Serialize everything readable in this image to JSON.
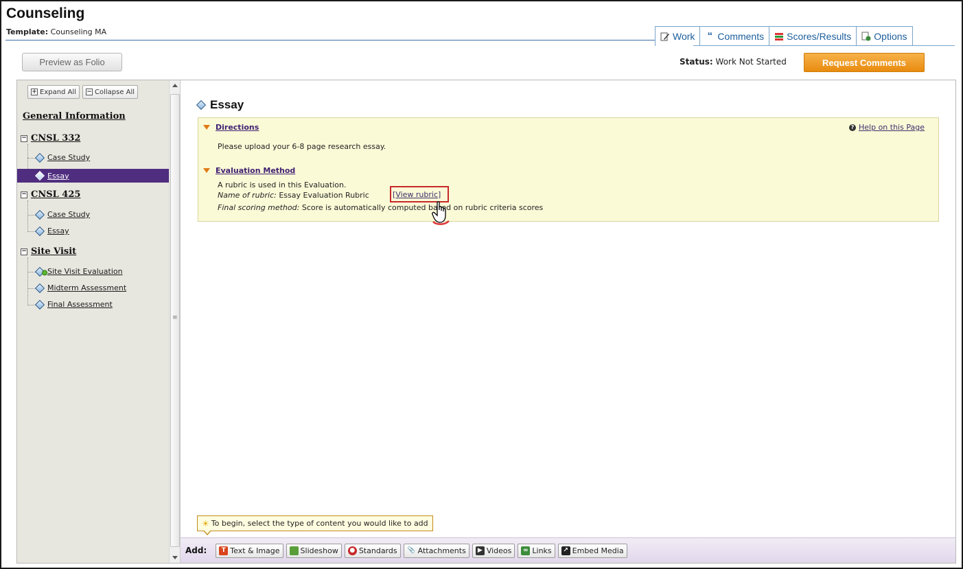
{
  "header": {
    "title": "Counseling",
    "template_label": "Template:",
    "template_value": "Counseling MA"
  },
  "tabs": [
    {
      "label": "Work",
      "icon": "pencil-page-icon"
    },
    {
      "label": "Comments",
      "icon": "quote-icon"
    },
    {
      "label": "Scores/Results",
      "icon": "scores-icon"
    },
    {
      "label": "Options",
      "icon": "options-icon"
    }
  ],
  "toolbar": {
    "preview_label": "Preview as Folio",
    "status_label": "Status:",
    "status_value": "Work Not Started",
    "request_label": "Request Comments"
  },
  "colors": {
    "accent_orange": "#e88b0f",
    "active_purple": "#4f2d7f",
    "link_purple": "#3e1f72",
    "tab_blue": "#1b5d9c"
  },
  "sidebar": {
    "expand_all": "Expand All",
    "collapse_all": "Collapse All",
    "general_info": "General Information",
    "groups": [
      {
        "label": "CNSL 332",
        "items": [
          "Case Study",
          "Essay"
        ]
      },
      {
        "label": "CNSL 425",
        "items": [
          "Case Study",
          "Essay"
        ]
      },
      {
        "label": "Site Visit",
        "items": [
          "Site Visit Evaluation",
          "Midterm Assessment",
          "Final Assessment"
        ]
      }
    ]
  },
  "content": {
    "page_title": "Essay",
    "directions_label": "Directions",
    "help_label": "Help on this Page",
    "directions_text": "Please upload your 6-8 page research essay.",
    "evaluation_label": "Evaluation Method",
    "eval_line1": "A rubric is used in this Evaluation.",
    "rubric_name_label": "Name of rubric:",
    "rubric_name_value": "Essay Evaluation Rubric",
    "view_rubric": "[View rubric]",
    "scoring_label": "Final scoring method:",
    "scoring_value": "Score is automatically computed based on rubric criteria scores"
  },
  "tooltip": "To begin, select the type of content you would like to add",
  "addbar": {
    "label": "Add:",
    "buttons": [
      "Text & Image",
      "Slideshow",
      "Standards",
      "Attachments",
      "Videos",
      "Links",
      "Embed Media"
    ]
  }
}
